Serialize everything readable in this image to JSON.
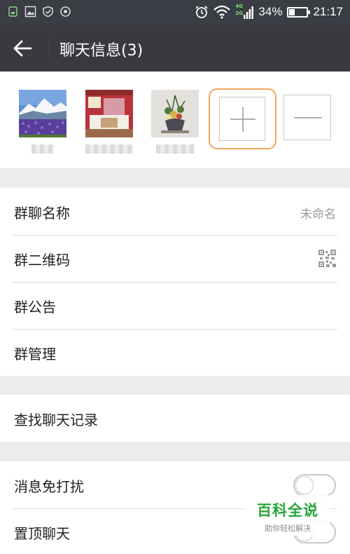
{
  "status_bar": {
    "battery_percent": "34%",
    "battery_level": 0.34,
    "time": "21:17",
    "network_4g": "4G",
    "network_2g": "2G",
    "left_icons": [
      "sim-icon",
      "image-icon",
      "shield-icon",
      "target-icon"
    ],
    "right_icons": [
      "alarm-icon",
      "wifi-icon",
      "signal-icon",
      "battery-icon"
    ]
  },
  "header": {
    "back_icon": "back-arrow-icon",
    "title": "聊天信息(3)"
  },
  "members": [
    {
      "name": "",
      "avatar": "mountain-lupine-photo"
    },
    {
      "name": "",
      "avatar": "flower-shop-photo"
    },
    {
      "name": "",
      "avatar": "ikebana-flowers-photo"
    }
  ],
  "member_actions": {
    "add_icon": "plus-icon",
    "remove_icon": "minus-icon"
  },
  "group_settings": {
    "name_label": "群聊名称",
    "name_value": "未命名",
    "qrcode_label": "群二维码",
    "qrcode_icon": "qrcode-icon",
    "notice_label": "群公告",
    "manage_label": "群管理"
  },
  "history": {
    "search_label": "查找聊天记录"
  },
  "notifications": {
    "mute_label": "消息免打扰",
    "mute_on": false,
    "pin_label": "置顶聊天",
    "pin_on": false
  },
  "watermark": {
    "title": "百科全说",
    "subtitle": "助你轻松解决"
  },
  "colors": {
    "title_bar": "#393a3f",
    "status_bar": "#3a3d43",
    "add_highlight": "#f2a65a",
    "watermark_green": "#27a53a"
  }
}
